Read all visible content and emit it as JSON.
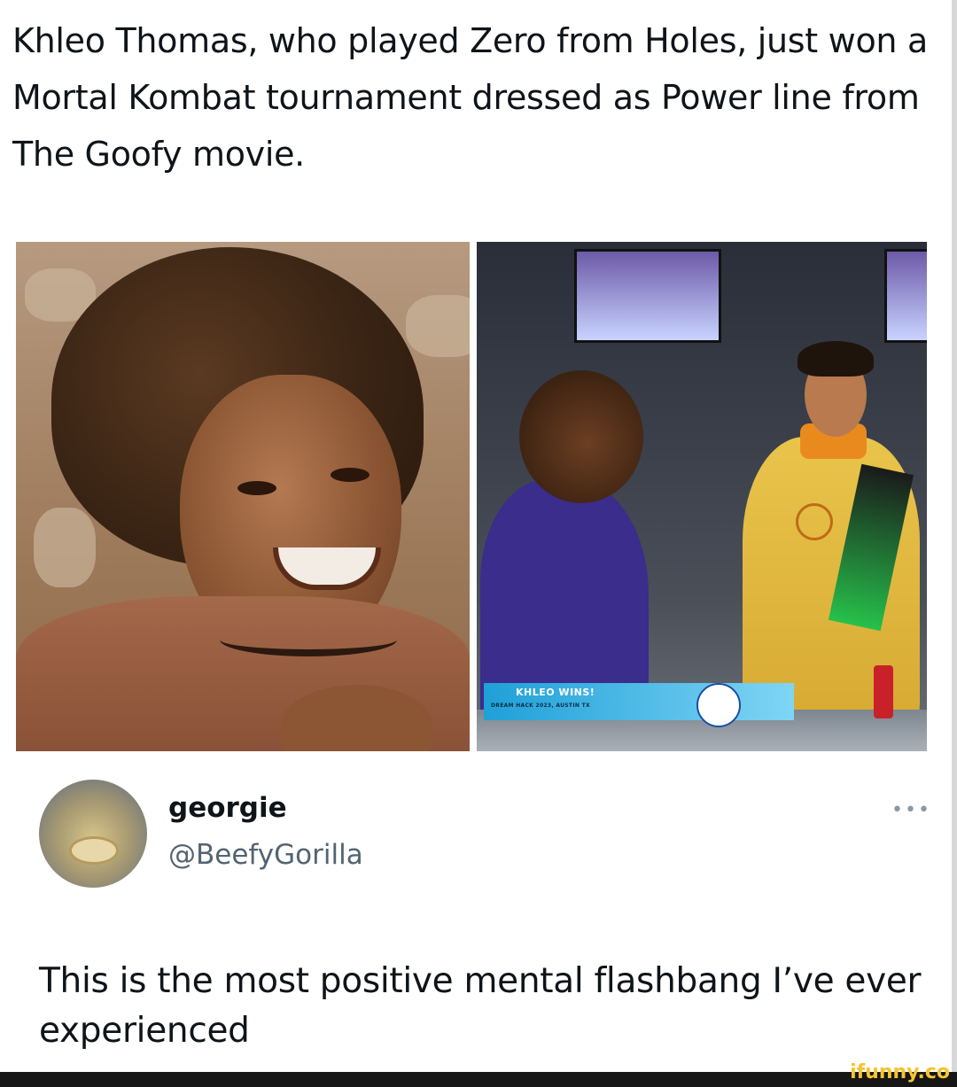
{
  "post": {
    "headline": "Khleo Thomas, who played Zero from Holes, just won a Mortal Kombat tournament dressed as Power line from The Goofy movie."
  },
  "images": {
    "right_banner": {
      "title": "KHLEO WINS!",
      "subtitle": "DREAM HACK 2023, AUSTIN TX"
    }
  },
  "tweet": {
    "display_name": "georgie",
    "handle": "@BeefyGorilla",
    "more_icon": "more-dots-icon",
    "text": "This is the most positive mental flashbang I’ve ever experienced"
  },
  "watermark": {
    "text": "ifunny.co"
  },
  "colors": {
    "handle": "#536471",
    "watermark": "#f6c42e",
    "text": "#0f1419"
  }
}
